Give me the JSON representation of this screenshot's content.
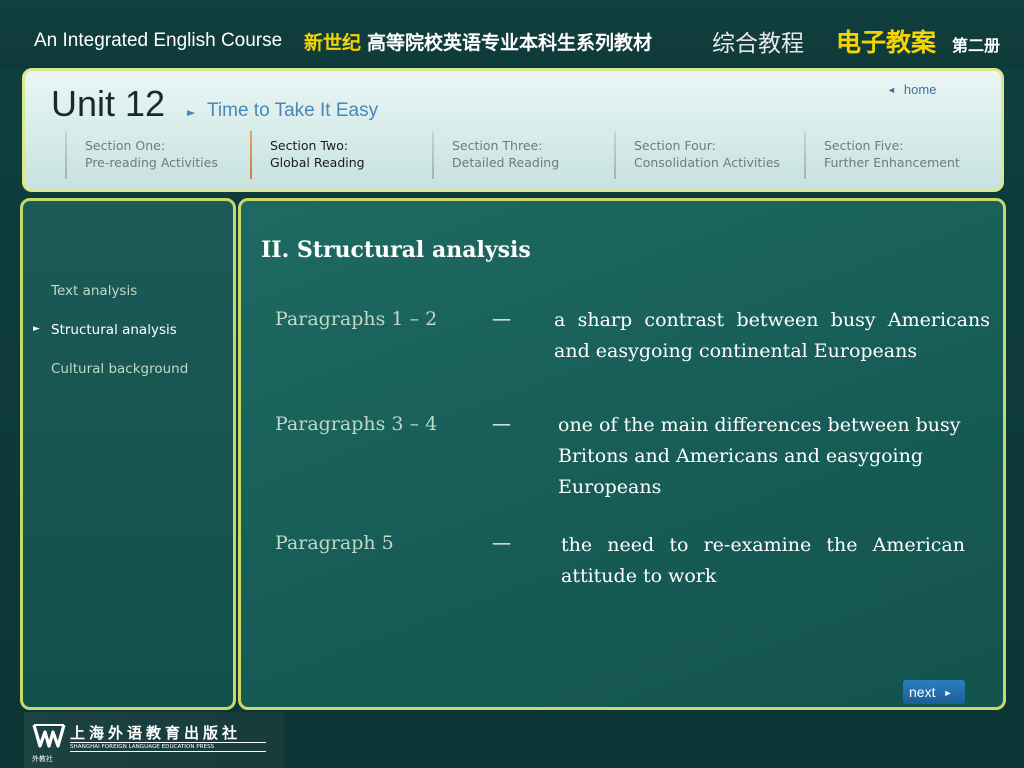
{
  "banner": {
    "course_title": "An Integrated English Course",
    "series_highlight": "新世纪",
    "series_rest": "高等院校英语专业本科生系列教材",
    "comprehensive": "综合教程",
    "e_lesson": "电子教案",
    "volume": "第二册"
  },
  "header": {
    "unit": "Unit 12",
    "subtitle": "Time to Take It Easy",
    "home": "home",
    "sections": [
      {
        "line1": "Section One:",
        "line2": "Pre-reading Activities"
      },
      {
        "line1": "Section Two:",
        "line2": "Global Reading"
      },
      {
        "line1": "Section Three:",
        "line2": "Detailed Reading"
      },
      {
        "line1": "Section Four:",
        "line2": "Consolidation Activities"
      },
      {
        "line1": "Section Five:",
        "line2": "Further Enhancement"
      }
    ],
    "active_section": 1
  },
  "left_nav": {
    "items": [
      "Text analysis",
      "Structural analysis",
      "Cultural background"
    ],
    "active_index": 1
  },
  "main": {
    "heading": "II. Structural analysis",
    "dash": "—",
    "rows": [
      {
        "paragraphs": "Paragraphs 1 – 2",
        "description": "a sharp contrast between busy Americans and easygoing continental Europeans"
      },
      {
        "paragraphs": "Paragraphs 3 – 4",
        "description": "one of the main differences between busy Britons and Americans and easygoing Europeans"
      },
      {
        "paragraphs": "Paragraph 5",
        "description": "the need to re-examine the American attitude to work"
      }
    ],
    "next": "next"
  },
  "footer": {
    "publisher_cn": "上海外语教育出版社",
    "publisher_en": "SHANGHAI FOREIGN LANGUAGE EDUCATION PRESS",
    "logo_small": "外教社"
  },
  "colors": {
    "background": "#0f3d3d",
    "panel_border": "#c8d86a",
    "accent_yellow": "#f5d400",
    "link_blue": "#4a86b8",
    "active_section_line": "#d47a3e"
  }
}
